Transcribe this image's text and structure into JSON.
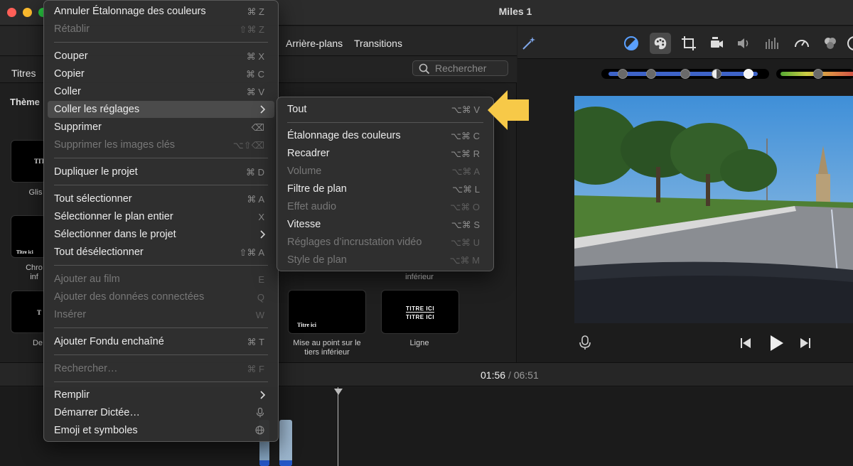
{
  "window": {
    "title": "Miles 1"
  },
  "browser": {
    "tabs": [
      "Arrière-plans",
      "Transitions"
    ],
    "left_tab": "Titres",
    "themes_label": "Thème",
    "search_placeholder": "Rechercher",
    "tiles": [
      {
        "label": "Glis",
        "thumb_text": "TIT"
      },
      {
        "label": "Chro\ninf",
        "thumb_text": "Titre ici"
      },
      {
        "label": "De",
        "thumb_text": "T"
      },
      {
        "label": "inférieur",
        "thumb_text": ""
      },
      {
        "label": "Mise au point sur le\ntiers inférieur",
        "thumb_text": "Titre ici"
      },
      {
        "label": "Ligne",
        "thumb_text": "TITRE ICI"
      }
    ]
  },
  "timeline": {
    "current": "01:56",
    "separator": "/",
    "total": "06:51"
  },
  "edit_menu": {
    "items": [
      {
        "label": "Annuler Étalonnage des couleurs",
        "shortcut": "⌘ Z",
        "enabled": true
      },
      {
        "label": "Rétablir",
        "shortcut": "⇧⌘ Z",
        "enabled": false
      },
      {
        "label": "Couper",
        "shortcut": "⌘ X",
        "enabled": true
      },
      {
        "label": "Copier",
        "shortcut": "⌘ C",
        "enabled": true
      },
      {
        "label": "Coller",
        "shortcut": "⌘ V",
        "enabled": true
      },
      {
        "label": "Coller les réglages",
        "shortcut": "",
        "enabled": true
      },
      {
        "label": "Supprimer",
        "shortcut": "⌫",
        "enabled": true
      },
      {
        "label": "Supprimer les images clés",
        "shortcut": "⌥⇧⌫",
        "enabled": false
      },
      {
        "label": "Dupliquer le projet",
        "shortcut": "⌘ D",
        "enabled": true
      },
      {
        "label": "Tout sélectionner",
        "shortcut": "⌘ A",
        "enabled": true
      },
      {
        "label": "Sélectionner le plan entier",
        "shortcut": "X",
        "enabled": true
      },
      {
        "label": "Sélectionner dans le projet",
        "shortcut": "",
        "enabled": true
      },
      {
        "label": "Tout désélectionner",
        "shortcut": "⇧⌘ A",
        "enabled": true
      },
      {
        "label": "Ajouter au film",
        "shortcut": "E",
        "enabled": false
      },
      {
        "label": "Ajouter des données connectées",
        "shortcut": "Q",
        "enabled": false
      },
      {
        "label": "Insérer",
        "shortcut": "W",
        "enabled": false
      },
      {
        "label": "Ajouter Fondu enchaîné",
        "shortcut": "⌘ T",
        "enabled": true
      },
      {
        "label": "Rechercher…",
        "shortcut": "⌘ F",
        "enabled": false
      },
      {
        "label": "Remplir",
        "shortcut": "",
        "enabled": true
      },
      {
        "label": "Démarrer Dictée…",
        "shortcut": "",
        "enabled": true
      },
      {
        "label": "Emoji et symboles",
        "shortcut": "",
        "enabled": true
      }
    ]
  },
  "paste_settings_menu": {
    "items": [
      {
        "label": "Tout",
        "shortcut": "⌥⌘ V",
        "enabled": true
      },
      {
        "label": "Étalonnage des couleurs",
        "shortcut": "⌥⌘ C",
        "enabled": true
      },
      {
        "label": "Recadrer",
        "shortcut": "⌥⌘ R",
        "enabled": true
      },
      {
        "label": "Volume",
        "shortcut": "⌥⌘ A",
        "enabled": false
      },
      {
        "label": "Filtre de plan",
        "shortcut": "⌥⌘ L",
        "enabled": true
      },
      {
        "label": "Effet audio",
        "shortcut": "⌥⌘ O",
        "enabled": false
      },
      {
        "label": "Vitesse",
        "shortcut": "⌥⌘ S",
        "enabled": true
      },
      {
        "label": "Réglages d’incrustation vidéo",
        "shortcut": "⌥⌘ U",
        "enabled": false
      },
      {
        "label": "Style de plan",
        "shortcut": "⌥⌘ M",
        "enabled": false
      }
    ]
  },
  "colors": {
    "highlight": "#4b4b4b",
    "accent_blue": "#3e63c8",
    "arrow_yellow": "#f7c948"
  }
}
